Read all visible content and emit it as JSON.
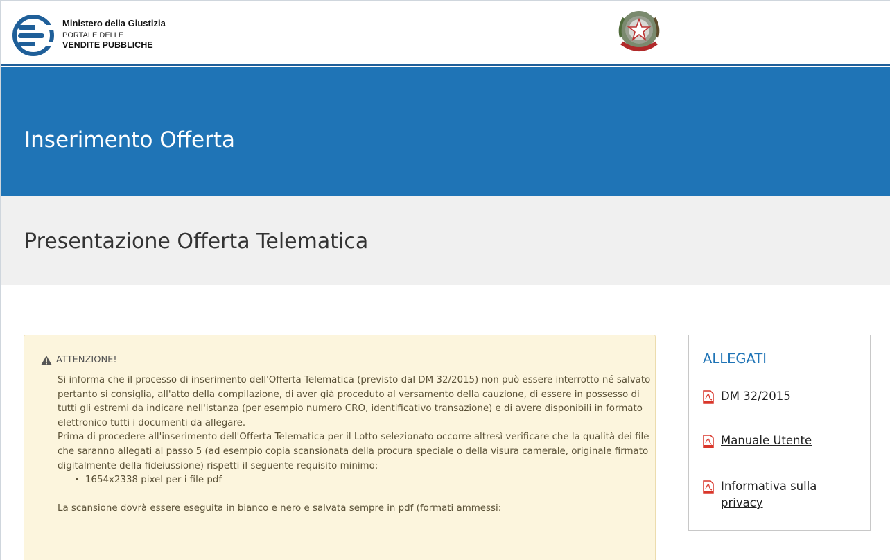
{
  "header": {
    "ministry": "Ministero della Giustizia",
    "portal_line1": "PORTALE DELLE",
    "portal_line2": "VENDITE PUBBLICHE",
    "logo_icon": "pvp-logo-icon",
    "emblem_icon": "italian-republic-emblem-icon"
  },
  "banner": {
    "title": "Inserimento Offerta"
  },
  "subheader": {
    "title": "Presentazione Offerta Telematica"
  },
  "warning": {
    "heading": "ATTENZIONE!",
    "paragraph1": "Si informa che il processo di inserimento dell'Offerta Telematica (previsto dal DM 32/2015) non può essere interrotto né salvato pertanto si consiglia, all'atto della compilazione, di aver già proceduto al versamento della cauzione, di essere in possesso di tutti gli estremi da indicare nell'istanza (per esempio numero CRO, identificativo transazione) e di avere disponibili in formato elettronico tutti i documenti da allegare.",
    "paragraph2": "Prima di procedere all'inserimento dell'Offerta Telematica per il Lotto selezionato occorre altresì verificare che la qualità dei file che saranno allegati al passo 5 (ad esempio copia scansionata della procura speciale o della visura camerale, originale firmato digitalmente della fideiussione) rispetti il seguente requisito minimo:",
    "requirements": [
      "1654x2338 pixel per i file pdf"
    ],
    "paragraph3": "La scansione dovrà essere eseguita in bianco e nero e salvata sempre in pdf (formati ammessi:"
  },
  "allegati": {
    "title": "ALLEGATI",
    "items": [
      {
        "label": "DM 32/2015",
        "icon": "pdf-icon"
      },
      {
        "label": "Manuale Utente",
        "icon": "pdf-icon"
      },
      {
        "label": "Informativa sulla privacy",
        "icon": "pdf-icon"
      }
    ]
  },
  "colors": {
    "banner": "#1f74b6",
    "subband": "#f0f0f0",
    "warning_bg": "#fcf5dd",
    "warning_text": "#5a5137",
    "pdf_red": "#d9372b"
  }
}
